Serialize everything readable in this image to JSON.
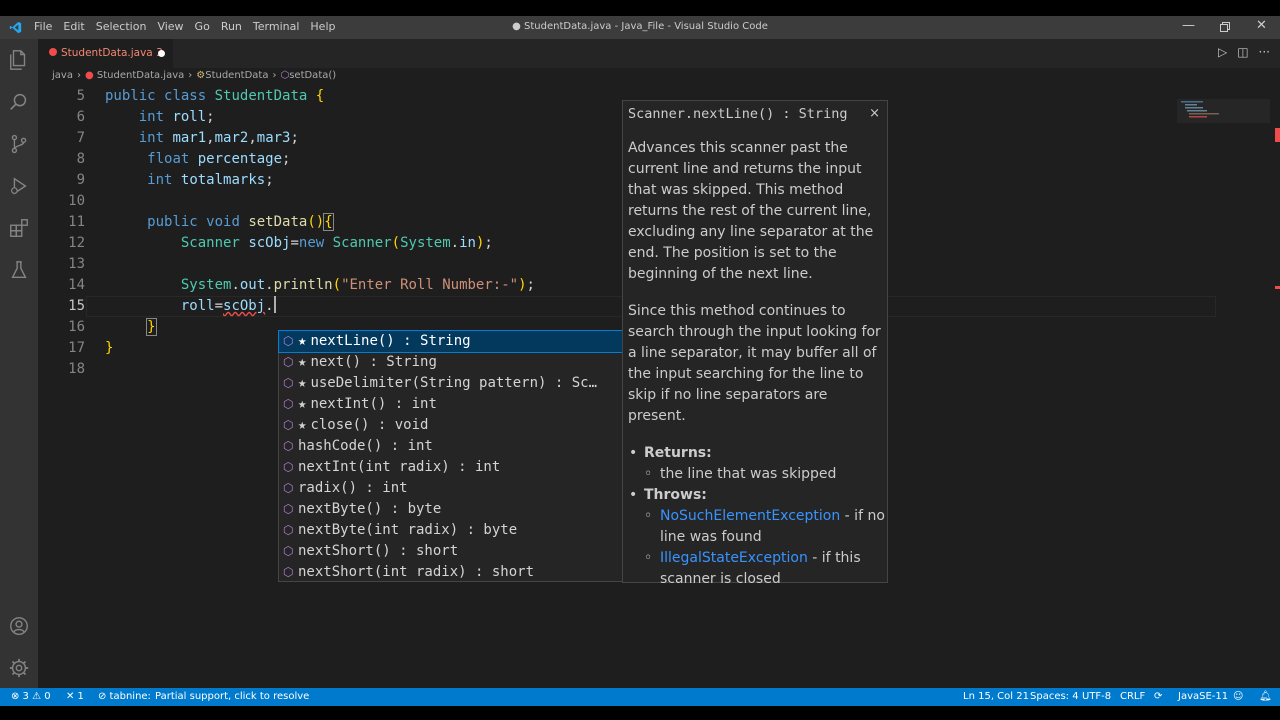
{
  "window": {
    "title": "● StudentData.java - Java_File - Visual Studio Code",
    "menu": [
      "File",
      "Edit",
      "Selection",
      "View",
      "Go",
      "Run",
      "Terminal",
      "Help"
    ]
  },
  "tab": {
    "label": "StudentData.java 3"
  },
  "breadcrumb": [
    "java",
    "StudentData.java",
    "StudentData",
    "setData()"
  ],
  "editor": {
    "line_numbers": [
      "5",
      "6",
      "7",
      "8",
      "9",
      "10",
      "11",
      "12",
      "13",
      "14",
      "15",
      "16",
      "17",
      "18"
    ],
    "current_line": "15"
  },
  "suggest": {
    "items": [
      {
        "label": "nextLine() : String",
        "star": true
      },
      {
        "label": "next() : String",
        "star": true
      },
      {
        "label": "useDelimiter(String pattern) : Sc…",
        "star": true
      },
      {
        "label": "nextInt() : int",
        "star": true
      },
      {
        "label": "close() : void",
        "star": true
      },
      {
        "label": "hashCode() : int",
        "star": false
      },
      {
        "label": "nextInt(int radix) : int",
        "star": false
      },
      {
        "label": "radix() : int",
        "star": false
      },
      {
        "label": "nextByte() : byte",
        "star": false
      },
      {
        "label": "nextByte(int radix) : byte",
        "star": false
      },
      {
        "label": "nextShort() : short",
        "star": false
      },
      {
        "label": "nextShort(int radix) : short",
        "star": false
      }
    ]
  },
  "docs": {
    "signature": "Scanner.nextLine() : String",
    "close": "×",
    "para1": "Advances this scanner past the current line and returns the input that was skipped. This method returns the rest of the current line, excluding any line separator at the end. The position is set to the beginning of the next line.",
    "para2": "Since this method continues to search through the input looking for a line separator, it may buffer all of the input searching for the line to skip if no line separators are present.",
    "returns_label": "Returns:",
    "returns_value": "the line that was skipped",
    "throws_label": "Throws:",
    "throws": [
      {
        "exception": "NoSuchElementException",
        "desc": " - if no line was found"
      },
      {
        "exception": "IllegalStateException",
        "desc": " - if this scanner is closed"
      }
    ]
  },
  "status": {
    "problems": "⊗ 3 ⚠ 0",
    "ports": "✕ 1",
    "tabnine": "⊘ tabnine:",
    "partial": "Partial support, click to resolve",
    "position": "Ln 15, Col 21",
    "spaces": "Spaces: 4",
    "encoding": "UTF-8",
    "eol": "CRLF",
    "language": "JavaSE-11"
  },
  "colors": {
    "accent": "#007acc",
    "editor_bg": "#1e1e1e",
    "selection": "#04395e"
  }
}
